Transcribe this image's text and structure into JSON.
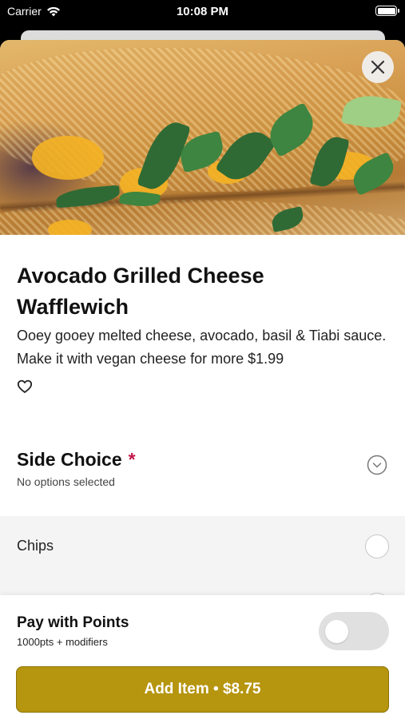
{
  "status_bar": {
    "carrier": "Carrier",
    "time": "10:08 PM"
  },
  "item": {
    "title": "Avocado Grilled Cheese Wafflewich",
    "description": "Ooey gooey melted cheese, avocado, basil & Tiabi sauce. Make it with vegan cheese for more $1.99"
  },
  "side_choice": {
    "heading": "Side Choice",
    "required_marker": "*",
    "selection_status": "No options selected",
    "options": [
      {
        "label": "Chips",
        "selected": false
      },
      {
        "label": "",
        "selected": false
      }
    ]
  },
  "points": {
    "title": "Pay with Points",
    "subtitle": "1000pts + modifiers",
    "enabled": false
  },
  "add_button": {
    "label": "Add Item • $8.75"
  },
  "colors": {
    "accent": "#b6950f",
    "required": "#c4174a",
    "option_bg": "#f4f4f4"
  },
  "icons": {
    "close": "close-icon",
    "favorite": "heart-outline-icon",
    "expand": "chevron-down-circle-icon",
    "wifi": "wifi-icon",
    "battery": "battery-icon"
  }
}
